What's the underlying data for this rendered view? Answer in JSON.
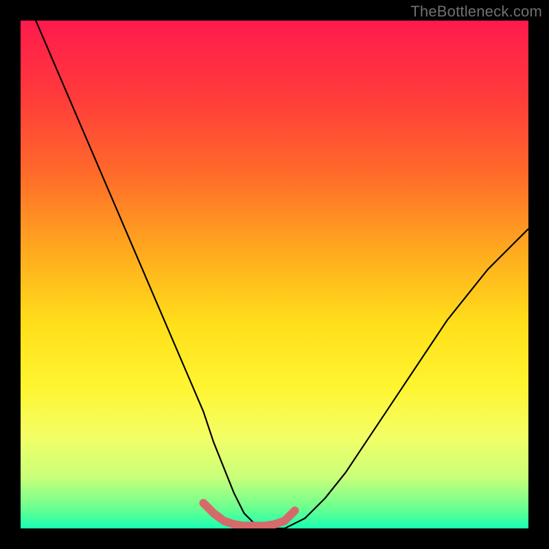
{
  "watermark": "TheBottleneck.com",
  "chart_data": {
    "type": "line",
    "title": "",
    "xlabel": "",
    "ylabel": "",
    "xlim": [
      0,
      100
    ],
    "ylim": [
      0,
      100
    ],
    "background_gradient": {
      "stops": [
        {
          "offset": 0.0,
          "color": "#ff1a4d"
        },
        {
          "offset": 0.15,
          "color": "#ff3b3b"
        },
        {
          "offset": 0.3,
          "color": "#ff6a2a"
        },
        {
          "offset": 0.45,
          "color": "#ffa81f"
        },
        {
          "offset": 0.6,
          "color": "#ffe01a"
        },
        {
          "offset": 0.72,
          "color": "#fff430"
        },
        {
          "offset": 0.82,
          "color": "#f3ff66"
        },
        {
          "offset": 0.9,
          "color": "#c8ff7a"
        },
        {
          "offset": 0.96,
          "color": "#6aff8f"
        },
        {
          "offset": 1.0,
          "color": "#19ffb3"
        }
      ]
    },
    "series": [
      {
        "name": "bottleneck-curve",
        "stroke": "#000000",
        "stroke_width": 2.2,
        "x": [
          3,
          6,
          9,
          12,
          15,
          18,
          21,
          24,
          27,
          30,
          33,
          36,
          38,
          40,
          42,
          44,
          46,
          48,
          52,
          56,
          60,
          64,
          68,
          72,
          76,
          80,
          84,
          88,
          92,
          96,
          100
        ],
        "y": [
          100,
          93,
          86,
          79,
          72,
          65,
          58,
          51,
          44,
          37,
          30,
          23,
          17,
          12,
          7,
          3,
          1,
          0,
          0,
          2,
          6,
          11,
          17,
          23,
          29,
          35,
          41,
          46,
          51,
          55,
          59
        ]
      },
      {
        "name": "trough-highlight",
        "stroke": "#d66a6a",
        "stroke_width": 12,
        "linecap": "round",
        "x": [
          36,
          38,
          40,
          42,
          44,
          46,
          48,
          50,
          52,
          54
        ],
        "y": [
          5,
          3,
          1.5,
          0.8,
          0.5,
          0.5,
          0.5,
          0.8,
          1.5,
          3.5
        ]
      }
    ]
  }
}
